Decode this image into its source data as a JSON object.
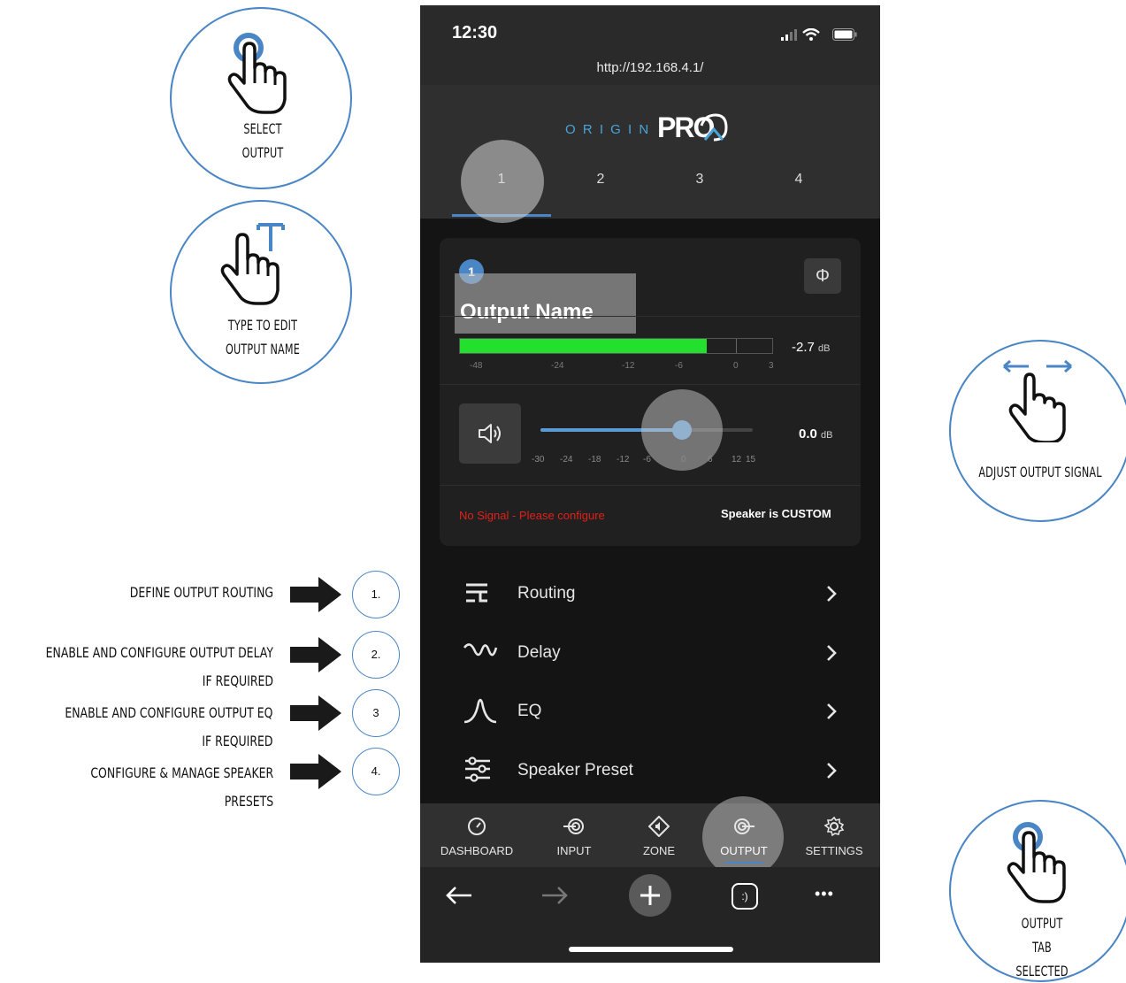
{
  "callouts": {
    "select_output": "SELECT OUTPUT",
    "type_to_edit": "TYPE TO EDIT OUTPUT NAME",
    "adjust_signal": "ADJUST OUTPUT SIGNAL",
    "output_tab": "OUTPUT TAB SELECTED"
  },
  "annotations": [
    {
      "number": "1.",
      "lines": [
        "DEFINE OUTPUT ROUTING"
      ]
    },
    {
      "number": "2.",
      "lines": [
        "ENABLE AND CONFIGURE OUTPUT DELAY",
        "IF REQUIRED"
      ]
    },
    {
      "number": "3",
      "lines": [
        "ENABLE AND CONFIGURE OUTPUT EQ",
        "IF REQUIRED"
      ]
    },
    {
      "number": "4.",
      "lines": [
        "CONFIGURE & MANAGE SPEAKER",
        "PRESETS"
      ]
    }
  ],
  "status_bar": {
    "time": "12:30",
    "url": "http://192.168.4.1/"
  },
  "logo": {
    "origin": "O R I G I N",
    "pro": "PRO"
  },
  "output_tabs": [
    "1",
    "2",
    "3",
    "4"
  ],
  "selected_tab": "1",
  "card": {
    "badge": "1",
    "phase_icon": "Φ",
    "output_name": "Output Name",
    "meter": {
      "level_value": "-2.7",
      "level_unit": "dB",
      "scale": [
        "-48",
        "-24",
        "-12",
        "-6",
        "0",
        "3"
      ],
      "fill_fraction": 0.79,
      "color": "#23e02e"
    },
    "volume": {
      "value": "0.0",
      "unit": "dB",
      "scale": [
        "-30",
        "-24",
        "-18",
        "-12",
        "-6",
        "0",
        "6",
        "12",
        "15"
      ],
      "level_db": 0
    },
    "no_signal": "No Signal - Please configure",
    "speaker_status": "Speaker is CUSTOM"
  },
  "menu": [
    {
      "label": "Routing",
      "icon": "routing-icon"
    },
    {
      "label": "Delay",
      "icon": "delay-icon"
    },
    {
      "label": "EQ",
      "icon": "eq-icon"
    },
    {
      "label": "Speaker Preset",
      "icon": "speaker-preset-icon"
    }
  ],
  "nav": [
    {
      "label": "DASHBOARD",
      "icon": "dashboard-icon"
    },
    {
      "label": "INPUT",
      "icon": "input-icon"
    },
    {
      "label": "ZONE",
      "icon": "zone-icon"
    },
    {
      "label": "OUTPUT",
      "icon": "output-icon"
    },
    {
      "label": "SETTINGS",
      "icon": "settings-icon"
    }
  ],
  "browser": {
    "tab_icon_label": ":)",
    "more": "•••"
  },
  "colors": {
    "accent": "#4a86c5",
    "meter_green": "#23e02e",
    "warning": "#e0201a",
    "slider": "#5b9bd5"
  }
}
